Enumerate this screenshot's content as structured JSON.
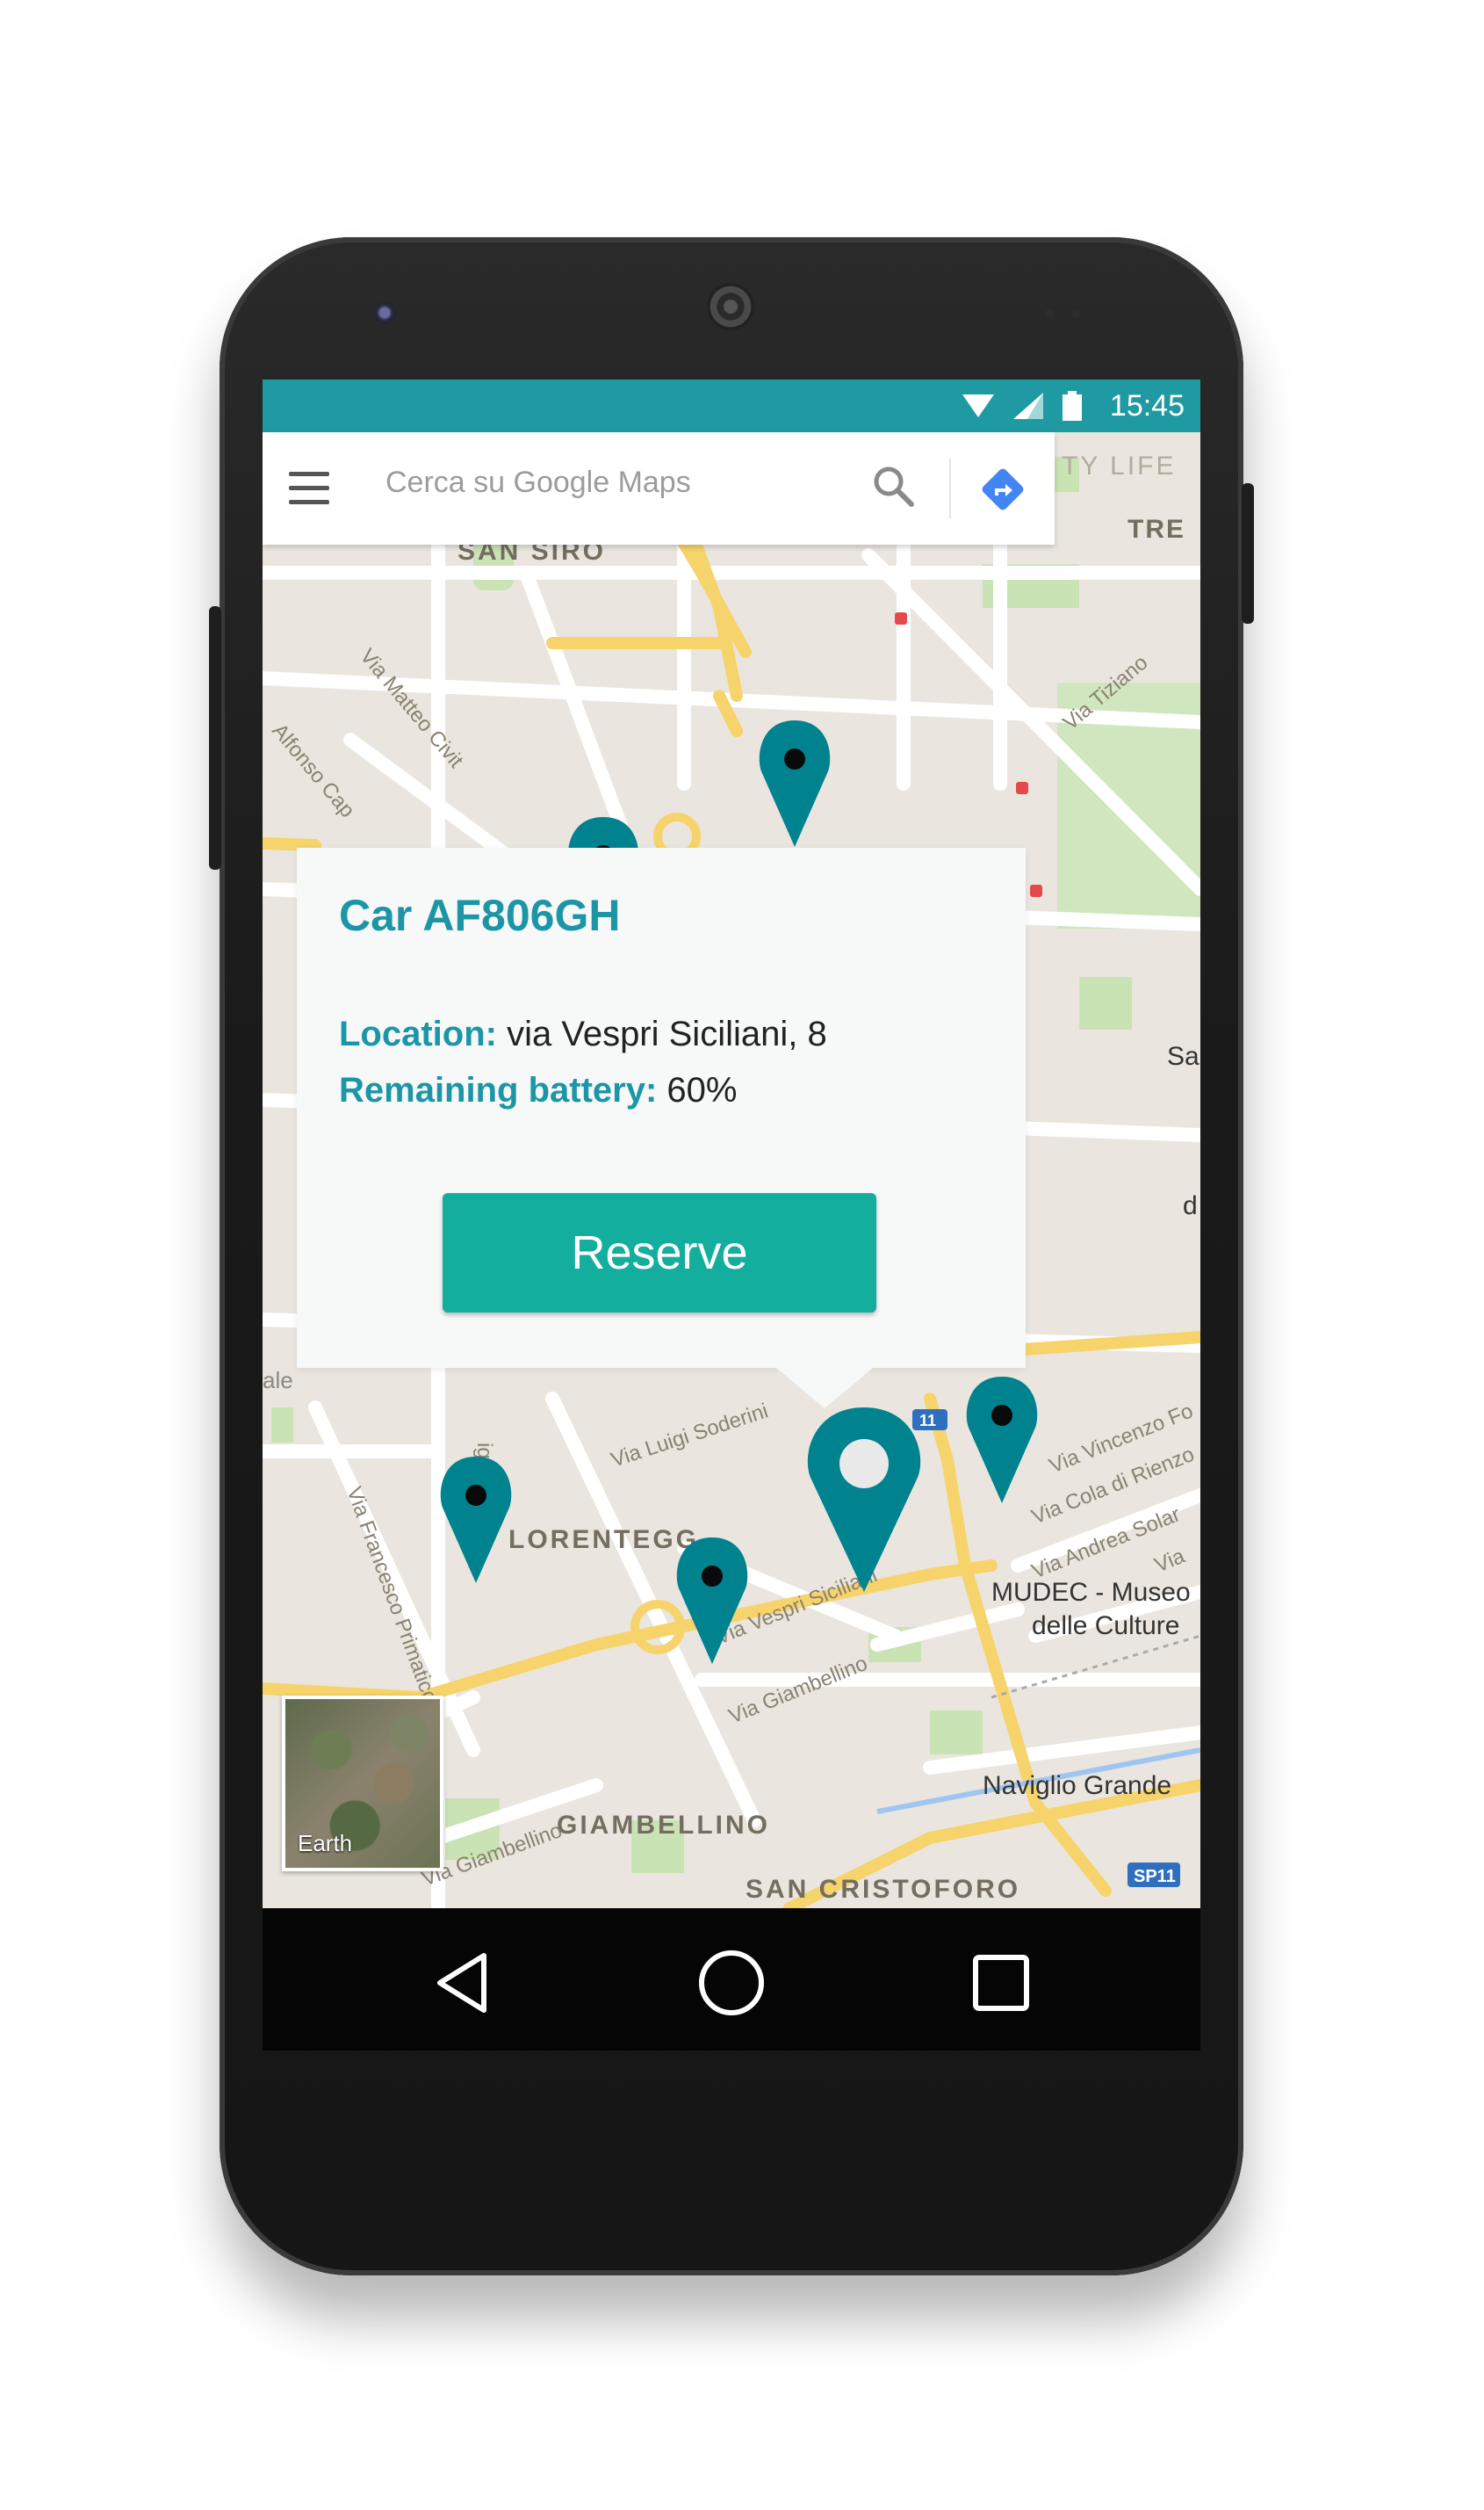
{
  "status_bar": {
    "time": "15:45"
  },
  "search": {
    "placeholder": "Cerca su Google Maps"
  },
  "map": {
    "layer_toggle_label": "Earth",
    "labels": {
      "san_siro": "SAN SIRO",
      "city_life": "TY LIFE",
      "tre": "TRE",
      "lorenteggio": "LORENTEGG",
      "giambellino": "GIAMBELLINO",
      "san_cristoforo": "SAN CRISTOFORO",
      "naviglio_grande": "Naviglio Grande",
      "mudec_1": "MUDEC - Museo",
      "mudec_2": "delle Culture",
      "sp11": "SP11",
      "via_matteo_civitali": "Via Matteo Civit",
      "via_alfonso": "Alfonso Cap",
      "via_tiziano": "Via Tiziano",
      "via_francesco": "Via Francesco Primaticcio",
      "via_luigi_soderini": "Via Luigi Soderini",
      "via_vespri": "Via Vespri Siciliani",
      "via_giambellino_1": "Via Giambellino",
      "via_giambellino_2": "Via Giambellino",
      "via_vincenzo": "Via Vincenzo Fo",
      "via_cola": "Via Cola di Rienzo",
      "via_andrea": "Via Andrea Solar",
      "via_ignano": "ignano",
      "via_short": "Via",
      "edge_sa": "Sa",
      "edge_d": "d",
      "edge_ale": "ale",
      "edge_sp11_top": "11"
    }
  },
  "popup": {
    "title": "Car AF806GH",
    "location_label": "Location:",
    "location_value": " via Vespri Siciliani, 8",
    "battery_label": "Remaining battery:",
    "battery_value": " 60%",
    "button_label": "Reserve"
  },
  "colors": {
    "accent": "#1f9aa2",
    "marker": "#00838f",
    "button": "#14ae9e",
    "map_background": "#eae6df"
  },
  "icons": {
    "menu": "hamburger-menu-icon",
    "search": "magnifier-search-icon",
    "directions": "directions-arrow-icon",
    "wifi": "wifi-icon",
    "signal": "cell-signal-icon",
    "battery": "battery-icon",
    "back": "back-triangle-icon",
    "home": "home-circle-icon",
    "recents": "recents-square-icon",
    "marker": "map-pin-icon"
  }
}
